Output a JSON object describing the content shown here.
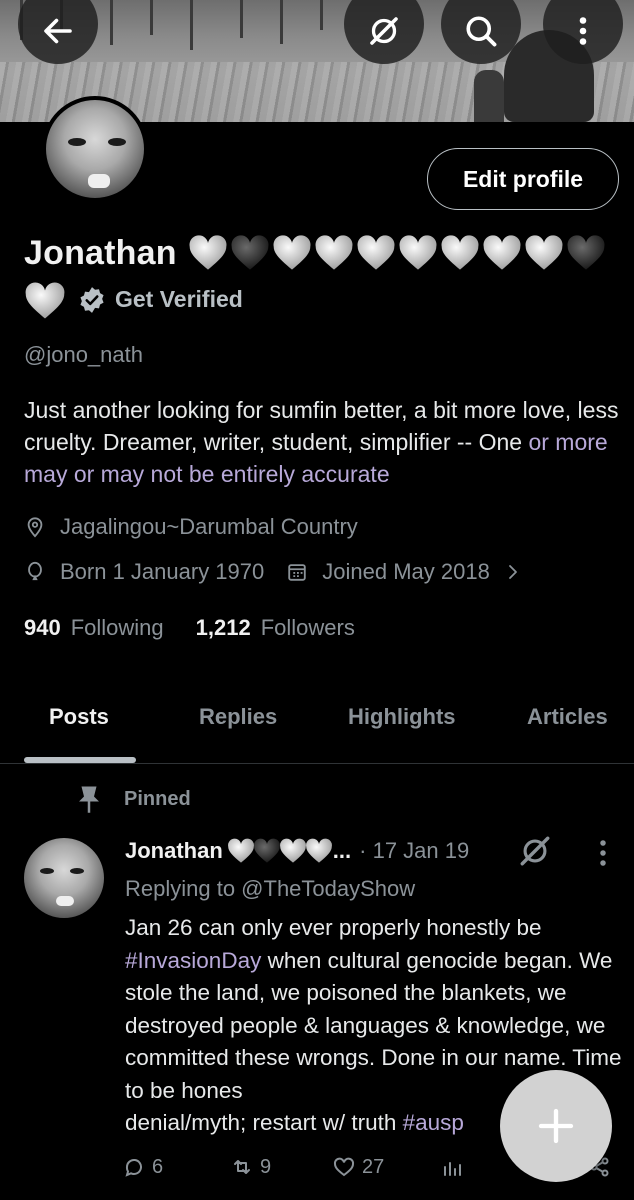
{
  "header": {
    "back_icon": "arrow-left-icon",
    "grok_icon": "grok-icon",
    "search_icon": "search-icon",
    "more_icon": "more-vertical-icon"
  },
  "profile": {
    "name": "Jonathan",
    "hearts": [
      "white",
      "black",
      "white",
      "white",
      "white",
      "white",
      "white",
      "white",
      "white",
      "black",
      "white"
    ],
    "get_verified": "Get Verified",
    "handle": "@jono_nath",
    "bio_main": "Just another looking for sumfin better, a bit more love, less cruelty.  Dreamer, writer, student, simplifier -- One ",
    "bio_link": "or more may or may not be entirely accurate",
    "location": "Jagalingou~Darumbal Country",
    "born": "Born 1 January 1970",
    "joined": "Joined May 2018",
    "following_count": "940",
    "following_label": "Following",
    "followers_count": "1,212",
    "followers_label": "Followers",
    "edit_button": "Edit profile"
  },
  "tabs": [
    "Posts",
    "Replies",
    "Highlights",
    "Articles"
  ],
  "active_tab": "Posts",
  "post": {
    "pinned_label": "Pinned",
    "author": "Jonathan",
    "ellipsis": "...",
    "date": "· 17 Jan 19",
    "replying_to": "Replying to @TheTodayShow",
    "text_1": "Jan 26 can only ever properly honestly be ",
    "tag_1": "#InvasionDay",
    "text_2": " when cultural genocide began. We stole the land, we poisoned the blankets, we destroyed people & languages & knowledge, we committed these wrongs. Done in our name. Time to be hones",
    "text_3": "denial/myth; restart w/ truth ",
    "tag_2": "#ausp",
    "replies": "6",
    "reposts": "9",
    "likes": "27"
  },
  "colors": {
    "background": "#000000",
    "text": "#e7e9ea",
    "muted": "#8b9298",
    "link": "#b8a9d9",
    "fab": "#d2d2d2"
  }
}
